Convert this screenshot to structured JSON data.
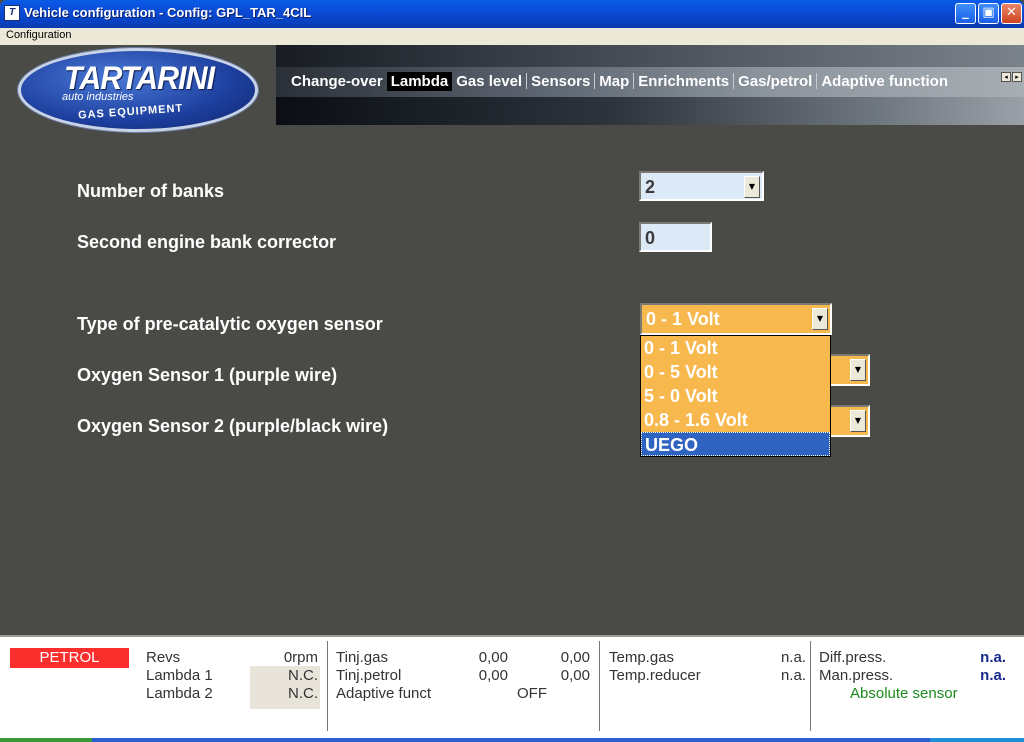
{
  "window": {
    "title": "Vehicle configuration - Config: GPL_TAR_4CIL",
    "app_icon": "tartarini-app-icon",
    "buttons": {
      "minimize": "_",
      "maximize": "▣",
      "close": "✕"
    }
  },
  "menubar": {
    "items": [
      {
        "label": "Configuration"
      }
    ]
  },
  "logo": {
    "brand": "TARTARINI",
    "sub": "auto industries",
    "tagline": "GAS EQUIPMENT"
  },
  "tabs": {
    "items": [
      "Change-over",
      "Lambda",
      "Gas level",
      "Sensors",
      "Map",
      "Enrichments",
      "Gas/petrol",
      "Adaptive function"
    ],
    "active": "Lambda"
  },
  "form": {
    "banks": {
      "label": "Number of banks",
      "value": "2"
    },
    "corrector": {
      "label": "Second engine bank corrector",
      "value": "0"
    },
    "sensor_type": {
      "label": "Type of pre-catalytic oxygen sensor",
      "value": "0 - 1 Volt",
      "options": [
        "0 - 1 Volt",
        "0 - 5 Volt",
        "5 - 0 Volt",
        "0.8 - 1.6 Volt",
        "UEGO"
      ],
      "highlighted": "UEGO"
    },
    "sensor1": {
      "label": "Oxygen Sensor 1 (purple wire)"
    },
    "sensor2": {
      "label": "Oxygen Sensor 2 (purple/black wire)"
    }
  },
  "status": {
    "mode": "PETROL",
    "revs": {
      "label": "Revs",
      "value": "0rpm"
    },
    "lambda1": {
      "label": "Lambda 1",
      "value": "N.C."
    },
    "lambda2": {
      "label": "Lambda 2",
      "value": "N.C."
    },
    "tinj_gas": {
      "label": "Tinj.gas",
      "v1": "0,00",
      "v2": "0,00"
    },
    "tinj_petrol": {
      "label": "Tinj.petrol",
      "v1": "0,00",
      "v2": "0,00"
    },
    "adaptive": {
      "label": "Adaptive funct",
      "value": "OFF"
    },
    "temp_gas": {
      "label": "Temp.gas",
      "value": "n.a."
    },
    "temp_reducer": {
      "label": "Temp.reducer",
      "value": "n.a."
    },
    "diff_press": {
      "label": "Diff.press.",
      "value": "n.a."
    },
    "man_press": {
      "label": "Man.press.",
      "value": "n.a."
    },
    "sensor_note": "Absolute sensor"
  },
  "colors": {
    "background": "#4a4a46",
    "accent_orange": "#f7b84e",
    "selection_blue": "#2f63c2",
    "petrol_red": "#fb2e2e",
    "status_green": "#1b8a1b"
  }
}
